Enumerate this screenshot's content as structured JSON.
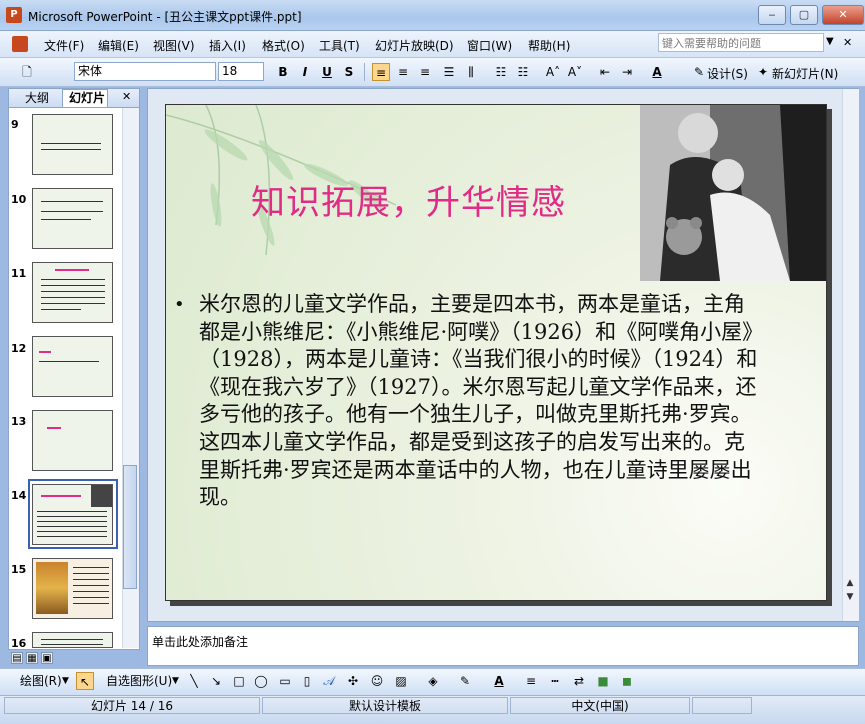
{
  "window": {
    "title": "Microsoft PowerPoint - [丑公主课文ppt课件.ppt]",
    "app_icon": "P",
    "minimize": "‒",
    "restore": "▢",
    "close": "✕"
  },
  "menu": {
    "items": [
      "文件(F)",
      "编辑(E)",
      "视图(V)",
      "插入(I)",
      "格式(O)",
      "工具(T)",
      "幻灯片放映(D)",
      "窗口(W)",
      "帮助(H)"
    ],
    "help_placeholder": "键入需要帮助的问题"
  },
  "toolbar": {
    "font_name": "宋体",
    "font_size": "18",
    "bold": "B",
    "italic": "I",
    "underline": "U",
    "shadow": "S",
    "design_label": "设计(S)",
    "new_slide_label": "新幻灯片(N)"
  },
  "left_panel": {
    "tabs": [
      "大纲",
      "幻灯片"
    ],
    "close_glyph": "✕",
    "thumbnails": [
      {
        "number": "9"
      },
      {
        "number": "10"
      },
      {
        "number": "11"
      },
      {
        "number": "12"
      },
      {
        "number": "13"
      },
      {
        "number": "14"
      },
      {
        "number": "15"
      },
      {
        "number": "16"
      }
    ],
    "selected": "14"
  },
  "slide": {
    "title": "知识拓展，升华情感",
    "bullet": "•",
    "body": "米尔恩的儿童文学作品，主要是四本书，两本是童话，主角都是小熊维尼：《小熊维尼·阿噗》（1926）和《阿噗角小屋》（1928），两本是儿童诗：《当我们很小的时候》（1924）和《现在我六岁了》（1927）。米尔恩写起儿童文学作品来，还多亏他的孩子。他有一个独生儿子，叫做克里斯托弗·罗宾。这四本儿童文学作品，都是受到这孩子的启发写出来的。克里斯托弗·罗宾还是两本童话中的人物，也在儿童诗里屡屡出现。"
  },
  "notes": {
    "placeholder": "单击此处添加备注"
  },
  "drawing_toolbar": {
    "draw_label": "绘图(R)",
    "autoshapes_label": "自选图形(U)"
  },
  "status": {
    "slide_indicator": "幻灯片 14 / 16",
    "template": "默认设计模板",
    "language": "中文(中国)"
  },
  "colors": {
    "title_pink": "#e02c86",
    "accent_blue": "#3b62b0"
  }
}
